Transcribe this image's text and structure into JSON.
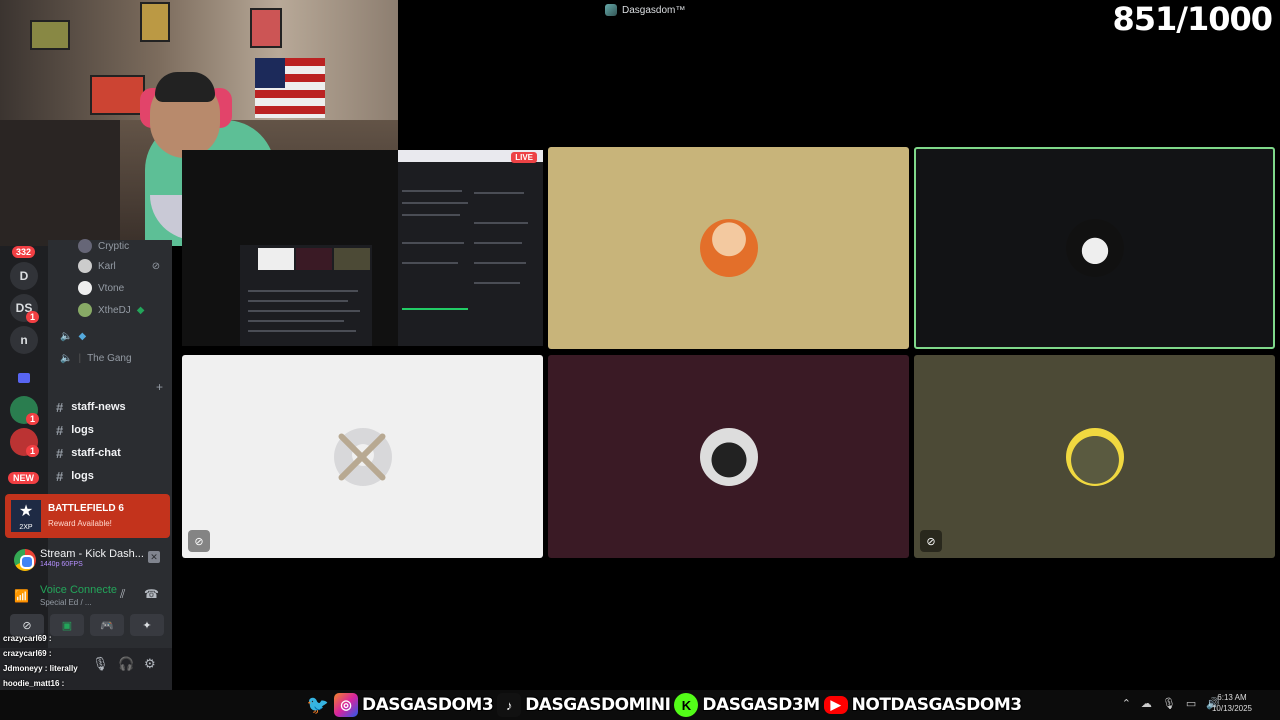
{
  "stage": {
    "title": "Dasgasdom™",
    "counter": "851/1000"
  },
  "screenshare": {
    "live_label": "LIVE"
  },
  "guilds": {
    "home_badge": "332",
    "items": [
      {
        "label": "D"
      },
      {
        "label": "DS",
        "badge": "1"
      },
      {
        "label": "n"
      }
    ],
    "badge_ones": [
      "1",
      "1"
    ],
    "new_label": "NEW"
  },
  "voice_users": [
    {
      "name": "Cryptic"
    },
    {
      "name": "Karl"
    },
    {
      "name": "Vtone"
    },
    {
      "name": "XtheDJ"
    }
  ],
  "voice_channels": [
    {
      "name": ""
    },
    {
      "name": "The Gang"
    }
  ],
  "text_channels": [
    {
      "name": "staff-news"
    },
    {
      "name": "logs"
    },
    {
      "name": "staff-chat"
    },
    {
      "name": "logs"
    }
  ],
  "promo": {
    "title": "BATTLEFIELD 6",
    "subtitle": "Reward Available!",
    "icon_label": "2XP"
  },
  "stream": {
    "title": "Stream - Kick Dash...",
    "subtitle": "1440p 60FPS"
  },
  "voice": {
    "status": "Voice Connecte",
    "channel": "Special Ed / ..."
  },
  "chat_overlay": [
    {
      "text": "crazycarl69 : "
    },
    {
      "text": "crazycarl69 : "
    },
    {
      "text": "Jdmoneyy : literally"
    },
    {
      "text": "hoodie_matt16 : "
    }
  ],
  "socials": [
    {
      "icon": "twitter-icon",
      "handle": "DASGASDOM3",
      "color": "#1da1f2"
    },
    {
      "icon": "instagram-icon",
      "handle": "",
      "color": "#d6249f"
    },
    {
      "icon": "tiktok-icon",
      "handle": "DASGASDOMINI",
      "color": "#111111"
    },
    {
      "icon": "kick-icon",
      "handle": "DASGASD3M",
      "color": "#53fc18"
    },
    {
      "icon": "youtube-icon",
      "handle": "NOTDASGASDOM3",
      "color": "#ff0000"
    }
  ],
  "clock": {
    "time": "6:13 AM",
    "date": "10/13/2025"
  },
  "tiles": [
    {
      "name": "tile-aang",
      "bg": "#c8b47a"
    },
    {
      "name": "tile-dark",
      "bg": "#121315",
      "speaking_border": "#7fd88a"
    },
    {
      "name": "tile-skull",
      "bg": "#f0f0f0"
    },
    {
      "name": "tile-cat",
      "bg": "#3a1a25"
    },
    {
      "name": "tile-gold",
      "bg": "#4c4a36"
    }
  ]
}
